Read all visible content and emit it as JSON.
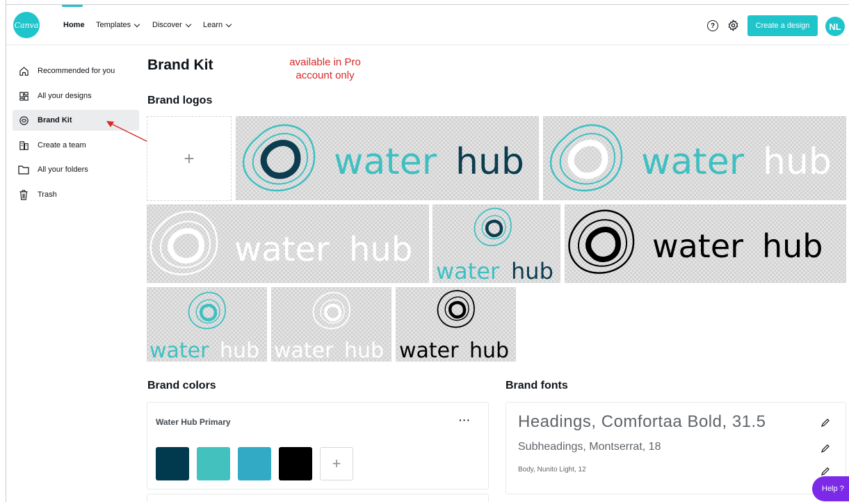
{
  "app": {
    "logo_text": "Canva"
  },
  "nav": {
    "home": "Home",
    "templates": "Templates",
    "discover": "Discover",
    "learn": "Learn"
  },
  "header": {
    "help_glyph": "?",
    "create_label": "Create a design",
    "avatar_initials": "NL"
  },
  "sidebar": {
    "items": [
      {
        "label": "Recommended for you",
        "icon": "home-icon"
      },
      {
        "label": "All your designs",
        "icon": "grid-icon"
      },
      {
        "label": "Brand Kit",
        "icon": "brand-kit-icon",
        "active": true
      },
      {
        "label": "Create a team",
        "icon": "team-icon"
      },
      {
        "label": "All your folders",
        "icon": "folder-icon"
      },
      {
        "label": "Trash",
        "icon": "trash-icon"
      }
    ]
  },
  "annotation": {
    "line1": "available in Pro",
    "line2": "account only",
    "color": "#d42a2a"
  },
  "main": {
    "title": "Brand Kit",
    "logos_title": "Brand logos",
    "add_glyph": "+",
    "logo_water": "water",
    "logo_hub": "hub",
    "colors_title": "Brand colors",
    "fonts_title": "Brand fonts"
  },
  "palette": {
    "name": "Water Hub Primary",
    "more": "···",
    "colors": [
      "#013a4e",
      "#43c1bf",
      "#32a9c5",
      "#000000"
    ],
    "add_glyph": "+"
  },
  "fonts": {
    "heading": "Headings, Comfortaa Bold, 31.5",
    "subheading": "Subheadings, Montserrat, 18",
    "body": "Body, Nunito Light, 12"
  },
  "help_label": "Help ?",
  "colors": {
    "accent": "#20c4cb",
    "purple": "#7d2ae8",
    "dark_teal": "#0b3c4f",
    "teal": "#3fbfc1"
  }
}
